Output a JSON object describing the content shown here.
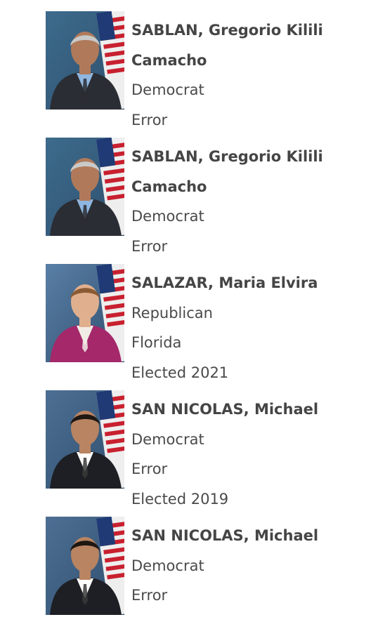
{
  "members": [
    {
      "name": "SABLAN, Gregorio Kilili Camacho",
      "party": "Democrat",
      "state": "Error",
      "elected": "",
      "photo": {
        "bg": "#3d6b8c",
        "suit": "#2a2d33",
        "shirt": "#8fb6e0",
        "hair": "#c9c9c9",
        "skin": "#b07a5a",
        "accent": "#2a2d33"
      }
    },
    {
      "name": "SABLAN, Gregorio Kilili Camacho",
      "party": "Democrat",
      "state": "Error",
      "elected": "",
      "photo": {
        "bg": "#3d6b8c",
        "suit": "#2a2d33",
        "shirt": "#8fb6e0",
        "hair": "#c9c9c9",
        "skin": "#b07a5a",
        "accent": "#2a2d33"
      }
    },
    {
      "name": "SALAZAR, Maria Elvira",
      "party": "Republican",
      "state": "Florida",
      "elected": "Elected 2021",
      "photo": {
        "bg": "#5a7fa6",
        "suit": "#a4286a",
        "shirt": "#f2ece6",
        "hair": "#8a5a34",
        "skin": "#e0b08e",
        "accent": "#f2ece6"
      }
    },
    {
      "name": "SAN NICOLAS, Michael",
      "party": "Democrat",
      "state": "Error",
      "elected": "Elected 2019",
      "photo": {
        "bg": "#4d6f93",
        "suit": "#1d1f24",
        "shirt": "#ffffff",
        "hair": "#1e1712",
        "skin": "#b98462",
        "accent": "#3a3a3a"
      }
    },
    {
      "name": "SAN NICOLAS, Michael",
      "party": "Democrat",
      "state": "Error",
      "elected": "",
      "photo": {
        "bg": "#4d6f93",
        "suit": "#1d1f24",
        "shirt": "#ffffff",
        "hair": "#1e1712",
        "skin": "#b98462",
        "accent": "#3a3a3a"
      }
    }
  ]
}
